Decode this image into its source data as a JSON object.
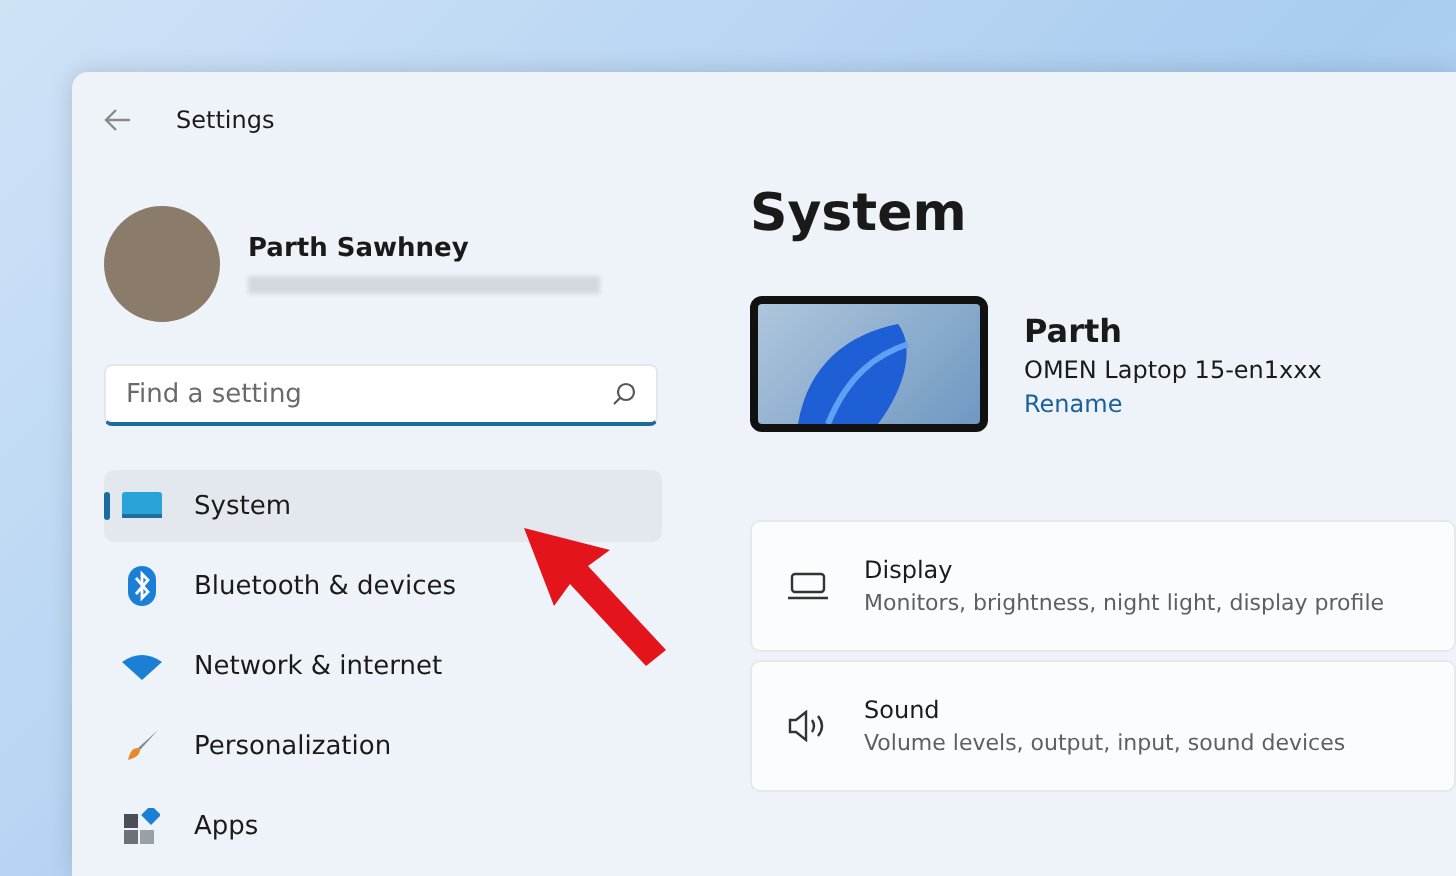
{
  "window": {
    "title": "Settings"
  },
  "user": {
    "name": "Parth Sawhney"
  },
  "search": {
    "placeholder": "Find a setting"
  },
  "nav": [
    {
      "label": "System",
      "selected": true
    },
    {
      "label": "Bluetooth & devices",
      "selected": false
    },
    {
      "label": "Network & internet",
      "selected": false
    },
    {
      "label": "Personalization",
      "selected": false
    },
    {
      "label": "Apps",
      "selected": false
    }
  ],
  "page": {
    "title": "System"
  },
  "device": {
    "name": "Parth",
    "model": "OMEN Laptop 15-en1xxx",
    "rename": "Rename"
  },
  "cards": [
    {
      "title": "Display",
      "description": "Monitors, brightness, night light, display profile"
    },
    {
      "title": "Sound",
      "description": "Volume levels, output, input, sound devices"
    }
  ]
}
